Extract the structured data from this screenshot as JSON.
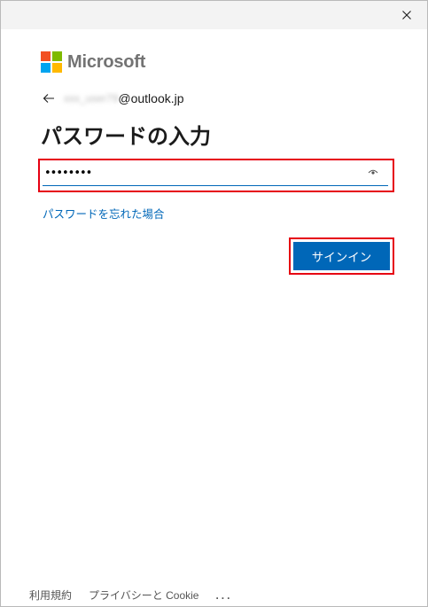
{
  "window": {
    "close_icon": "close-icon"
  },
  "logo": {
    "text": "Microsoft",
    "colors": [
      "#f25022",
      "#7fba00",
      "#00a4ef",
      "#ffb900"
    ]
  },
  "identity": {
    "masked_user": "xxx_user79",
    "domain": "@outlook.jp",
    "back_icon": "arrow-left-icon"
  },
  "page": {
    "title": "パスワードの入力"
  },
  "password": {
    "value": "••••••••",
    "reveal_icon": "eye-icon"
  },
  "links": {
    "forgot": "パスワードを忘れた場合"
  },
  "buttons": {
    "signin": "サインイン"
  },
  "footer": {
    "terms": "利用規約",
    "privacy": "プライバシーと Cookie",
    "more": "..."
  },
  "highlight_color": "#e60012",
  "accent_color": "#0067b8"
}
